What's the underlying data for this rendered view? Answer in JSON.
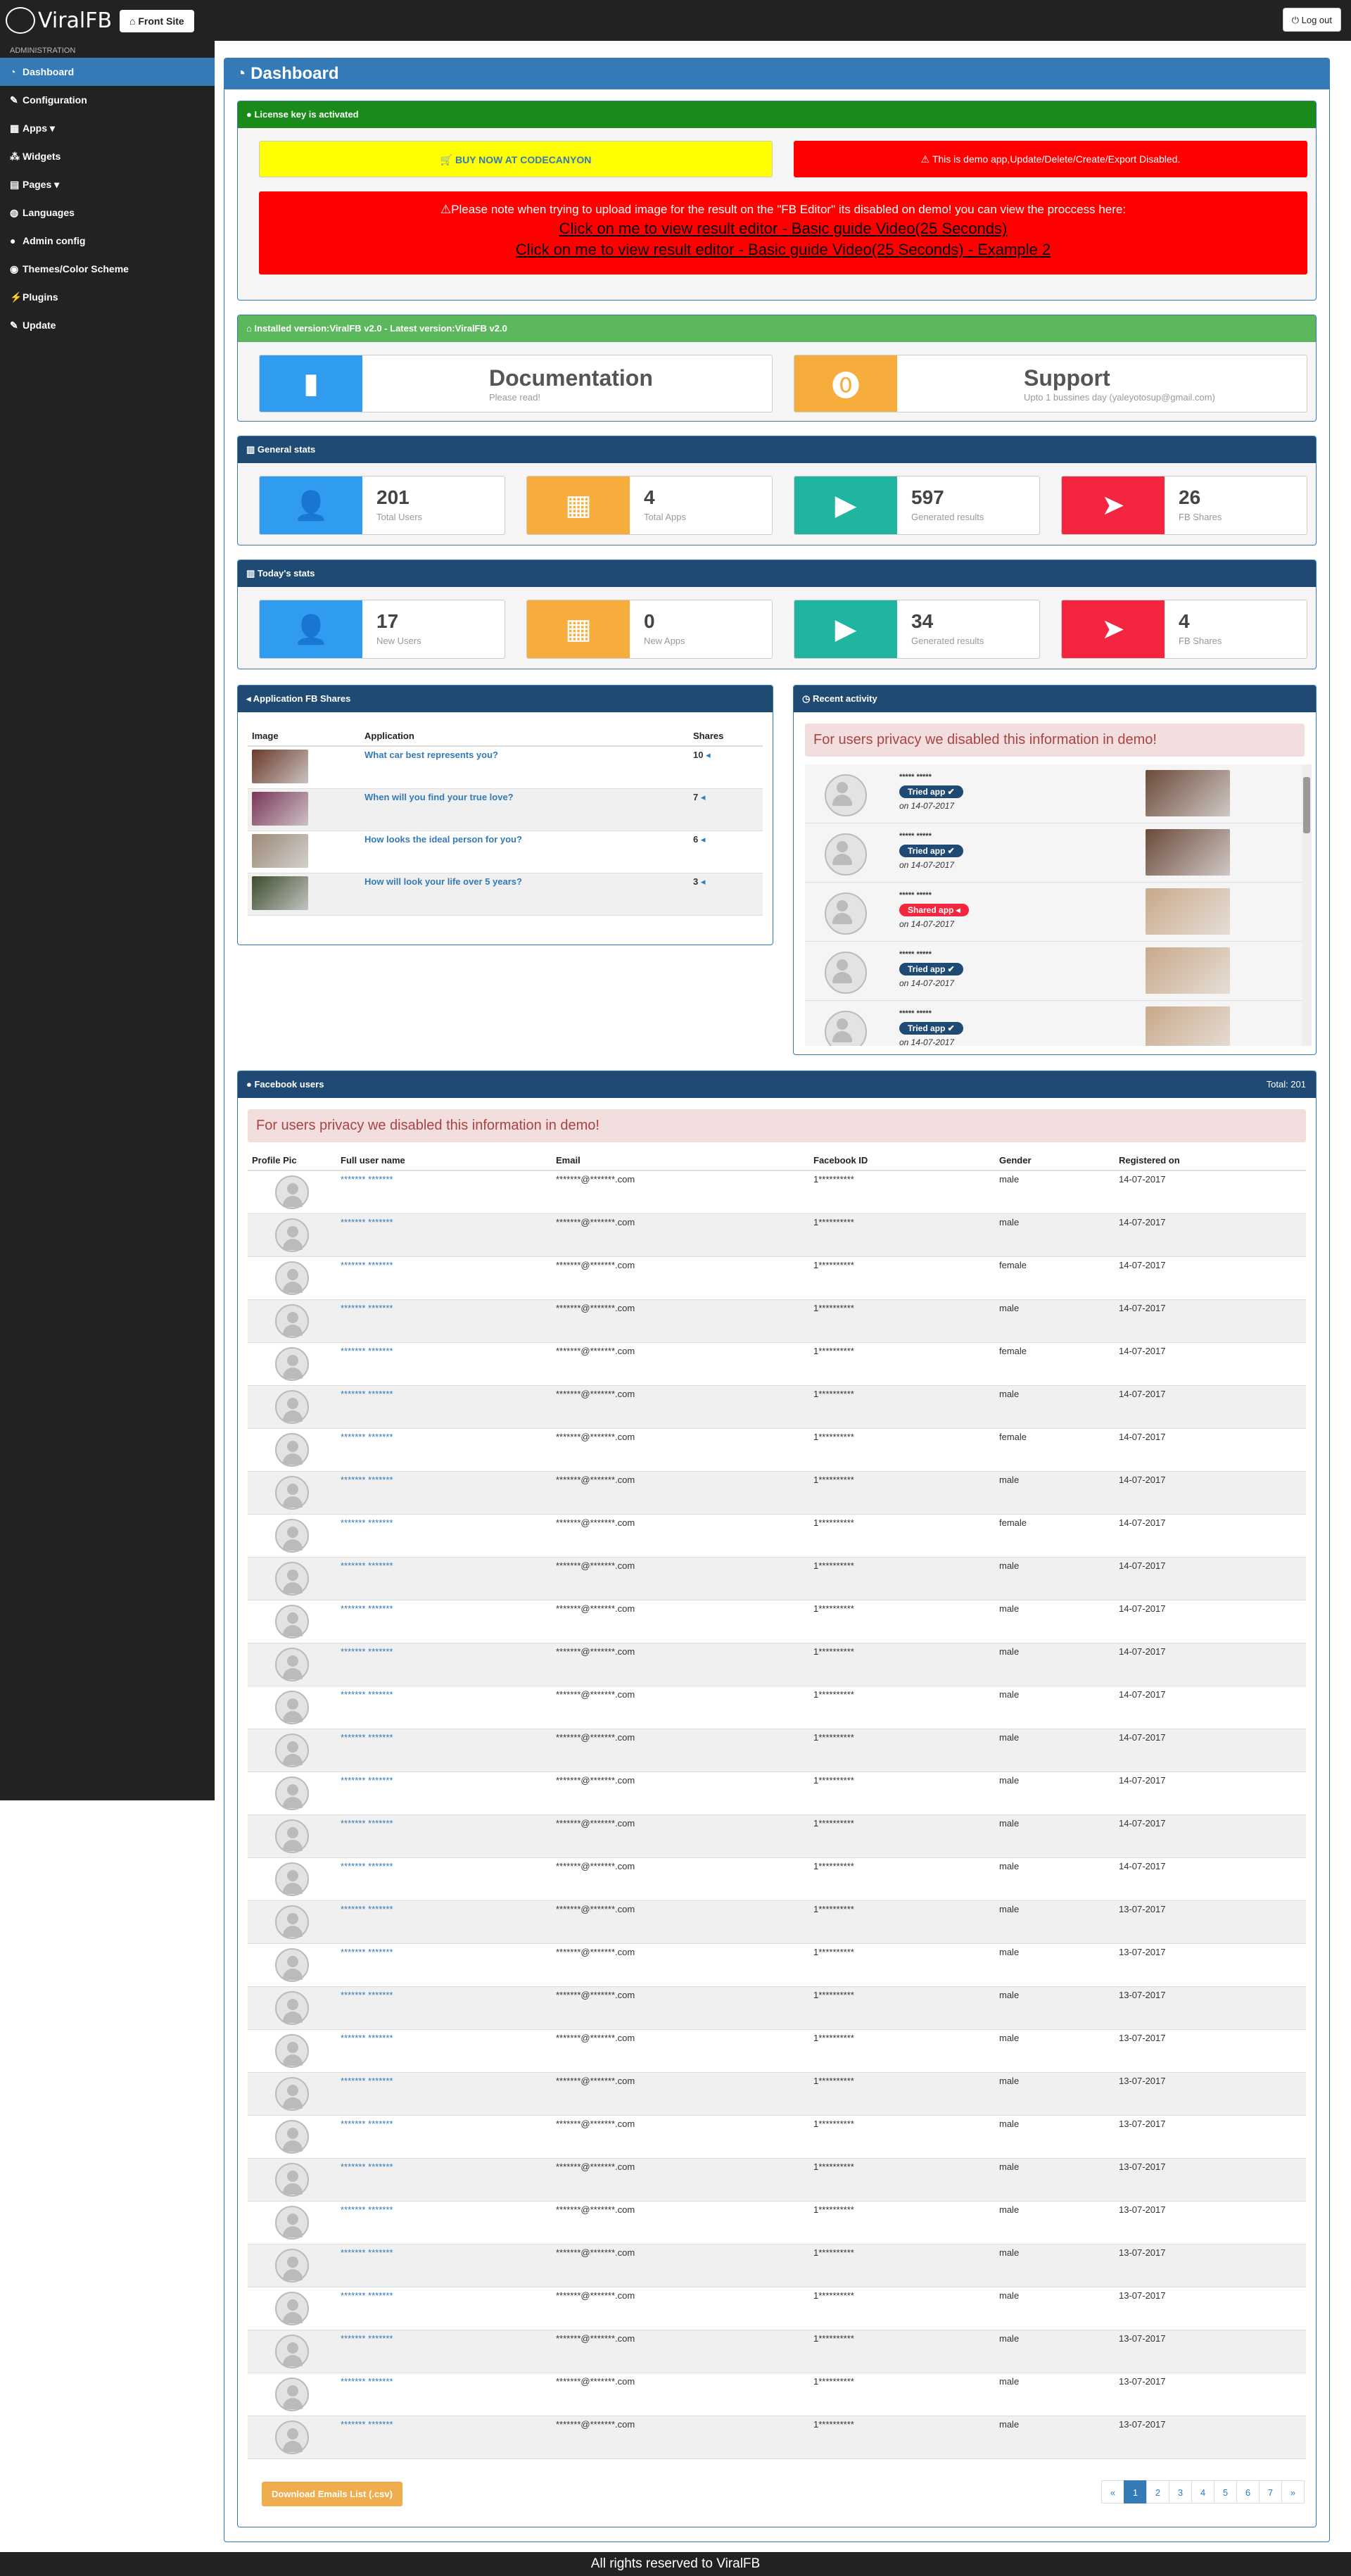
{
  "topbar": {
    "logo": "ViralFB",
    "front_site": "Front Site",
    "logout": "Log out"
  },
  "sidebar": {
    "heading": "ADMINISTRATION",
    "items": [
      {
        "label": "Dashboard",
        "icon": "dashboard-icon",
        "glyph": "◔"
      },
      {
        "label": "Configuration",
        "icon": "wrench-icon",
        "glyph": "✎"
      },
      {
        "label": "Apps ▾",
        "icon": "grid-icon",
        "glyph": "▦"
      },
      {
        "label": "Widgets",
        "icon": "cubes-icon",
        "glyph": "⁂"
      },
      {
        "label": "Pages ▾",
        "icon": "files-icon",
        "glyph": "▤"
      },
      {
        "label": "Languages",
        "icon": "globe-icon",
        "glyph": "◍"
      },
      {
        "label": "Admin config",
        "icon": "user-icon",
        "glyph": "●"
      },
      {
        "label": "Themes/Color Scheme",
        "icon": "eye-icon",
        "glyph": "◉"
      },
      {
        "label": "Plugins",
        "icon": "plug-icon",
        "glyph": "⚡"
      },
      {
        "label": "Update",
        "icon": "wrench-icon",
        "glyph": "✎"
      }
    ]
  },
  "dashboard": {
    "title": "Dashboard"
  },
  "license": {
    "header": "License key is activated",
    "buy": "BUY NOW AT CODECANYON",
    "demo": "This is demo app,Update/Delete/Create/Export Disabled.",
    "note": "Please note when trying to upload image for the result on the \"FB Editor\" its disabled on demo! you can view the proccess here:",
    "link1": "Click on me to view result editor - Basic guide Video(25 Seconds)",
    "link2": "Click on me to view result editor - Basic guide Video(25 Seconds) - Example 2"
  },
  "version": {
    "header": "Installed version:ViralFB v2.0 - Latest version:ViralFB v2.0",
    "doc_title": "Documentation",
    "doc_sub": "Please read!",
    "support_title": "Support",
    "support_sub": "Upto 1 bussines day (yaleyotosup@gmail.com)"
  },
  "general_stats": {
    "header": "General stats",
    "boxes": [
      {
        "num": "201",
        "label": "Total Users"
      },
      {
        "num": "4",
        "label": "Total Apps"
      },
      {
        "num": "597",
        "label": "Generated results"
      },
      {
        "num": "26",
        "label": "FB Shares"
      }
    ]
  },
  "today_stats": {
    "header": "Today's stats",
    "boxes": [
      {
        "num": "17",
        "label": "New Users"
      },
      {
        "num": "0",
        "label": "New Apps"
      },
      {
        "num": "34",
        "label": "Generated results"
      },
      {
        "num": "4",
        "label": "FB Shares"
      }
    ]
  },
  "app_shares": {
    "header": "Application FB Shares",
    "columns": [
      "Image",
      "Application",
      "Shares"
    ],
    "rows": [
      {
        "app": "What car best represents you?",
        "shares": "10",
        "color": "#6b3a2a"
      },
      {
        "app": "When will you find your true love?",
        "shares": "7",
        "color": "#7a3658"
      },
      {
        "app": "How looks the ideal person for you?",
        "shares": "6",
        "color": "#9c8a77"
      },
      {
        "app": "How will look your life over 5 years?",
        "shares": "3",
        "color": "#3d4c2e"
      }
    ]
  },
  "activity": {
    "header": "Recent activity",
    "privacy": "For users privacy we disabled this information in demo!",
    "items": [
      {
        "name": "***** *****",
        "badge": "Tried app ✔",
        "type": "tried",
        "date": "on 14-07-2017",
        "color": "#6b4a3a"
      },
      {
        "name": "***** *****",
        "badge": "Tried app ✔",
        "type": "tried",
        "date": "on 14-07-2017",
        "color": "#6b4a3a"
      },
      {
        "name": "***** *****",
        "badge": "Shared app ◂",
        "type": "shared",
        "date": "on 14-07-2017",
        "color": "#c9a98a"
      },
      {
        "name": "***** *****",
        "badge": "Tried app ✔",
        "type": "tried",
        "date": "on 14-07-2017",
        "color": "#c9a98a"
      },
      {
        "name": "***** *****",
        "badge": "Tried app ✔",
        "type": "tried",
        "date": "on 14-07-2017",
        "color": "#c9a98a"
      }
    ]
  },
  "fb_users": {
    "header": "Facebook users",
    "total": "Total: 201",
    "privacy": "For users privacy we disabled this information in demo!",
    "columns": [
      "Profile Pic",
      "Full user name",
      "Email",
      "Facebook ID",
      "Gender",
      "Registered on"
    ],
    "rows": [
      {
        "name": "******* *******",
        "email": "*******@*******.com",
        "id": "1**********",
        "gender": "male",
        "date": "14-07-2017"
      },
      {
        "name": "******* *******",
        "email": "*******@*******.com",
        "id": "1**********",
        "gender": "male",
        "date": "14-07-2017"
      },
      {
        "name": "******* *******",
        "email": "*******@*******.com",
        "id": "1**********",
        "gender": "female",
        "date": "14-07-2017"
      },
      {
        "name": "******* *******",
        "email": "*******@*******.com",
        "id": "1**********",
        "gender": "male",
        "date": "14-07-2017"
      },
      {
        "name": "******* *******",
        "email": "*******@*******.com",
        "id": "1**********",
        "gender": "female",
        "date": "14-07-2017"
      },
      {
        "name": "******* *******",
        "email": "*******@*******.com",
        "id": "1**********",
        "gender": "male",
        "date": "14-07-2017"
      },
      {
        "name": "******* *******",
        "email": "*******@*******.com",
        "id": "1**********",
        "gender": "female",
        "date": "14-07-2017"
      },
      {
        "name": "******* *******",
        "email": "*******@*******.com",
        "id": "1**********",
        "gender": "male",
        "date": "14-07-2017"
      },
      {
        "name": "******* *******",
        "email": "*******@*******.com",
        "id": "1**********",
        "gender": "female",
        "date": "14-07-2017"
      },
      {
        "name": "******* *******",
        "email": "*******@*******.com",
        "id": "1**********",
        "gender": "male",
        "date": "14-07-2017"
      },
      {
        "name": "******* *******",
        "email": "*******@*******.com",
        "id": "1**********",
        "gender": "male",
        "date": "14-07-2017"
      },
      {
        "name": "******* *******",
        "email": "*******@*******.com",
        "id": "1**********",
        "gender": "male",
        "date": "14-07-2017"
      },
      {
        "name": "******* *******",
        "email": "*******@*******.com",
        "id": "1**********",
        "gender": "male",
        "date": "14-07-2017"
      },
      {
        "name": "******* *******",
        "email": "*******@*******.com",
        "id": "1**********",
        "gender": "male",
        "date": "14-07-2017"
      },
      {
        "name": "******* *******",
        "email": "*******@*******.com",
        "id": "1**********",
        "gender": "male",
        "date": "14-07-2017"
      },
      {
        "name": "******* *******",
        "email": "*******@*******.com",
        "id": "1**********",
        "gender": "male",
        "date": "14-07-2017"
      },
      {
        "name": "******* *******",
        "email": "*******@*******.com",
        "id": "1**********",
        "gender": "male",
        "date": "14-07-2017"
      },
      {
        "name": "******* *******",
        "email": "*******@*******.com",
        "id": "1**********",
        "gender": "male",
        "date": "13-07-2017"
      },
      {
        "name": "******* *******",
        "email": "*******@*******.com",
        "id": "1**********",
        "gender": "male",
        "date": "13-07-2017"
      },
      {
        "name": "******* *******",
        "email": "*******@*******.com",
        "id": "1**********",
        "gender": "male",
        "date": "13-07-2017"
      },
      {
        "name": "******* *******",
        "email": "*******@*******.com",
        "id": "1**********",
        "gender": "male",
        "date": "13-07-2017"
      },
      {
        "name": "******* *******",
        "email": "*******@*******.com",
        "id": "1**********",
        "gender": "male",
        "date": "13-07-2017"
      },
      {
        "name": "******* *******",
        "email": "*******@*******.com",
        "id": "1**********",
        "gender": "male",
        "date": "13-07-2017"
      },
      {
        "name": "******* *******",
        "email": "*******@*******.com",
        "id": "1**********",
        "gender": "male",
        "date": "13-07-2017"
      },
      {
        "name": "******* *******",
        "email": "*******@*******.com",
        "id": "1**********",
        "gender": "male",
        "date": "13-07-2017"
      },
      {
        "name": "******* *******",
        "email": "*******@*******.com",
        "id": "1**********",
        "gender": "male",
        "date": "13-07-2017"
      },
      {
        "name": "******* *******",
        "email": "*******@*******.com",
        "id": "1**********",
        "gender": "male",
        "date": "13-07-2017"
      },
      {
        "name": "******* *******",
        "email": "*******@*******.com",
        "id": "1**********",
        "gender": "male",
        "date": "13-07-2017"
      },
      {
        "name": "******* *******",
        "email": "*******@*******.com",
        "id": "1**********",
        "gender": "male",
        "date": "13-07-2017"
      },
      {
        "name": "******* *******",
        "email": "*******@*******.com",
        "id": "1**********",
        "gender": "male",
        "date": "13-07-2017"
      }
    ],
    "download": "Download Emails List (.csv)",
    "pages": [
      "«",
      "1",
      "2",
      "3",
      "4",
      "5",
      "6",
      "7",
      "»"
    ],
    "active_page": "1"
  },
  "footer": "All rights reserved to ViralFB"
}
